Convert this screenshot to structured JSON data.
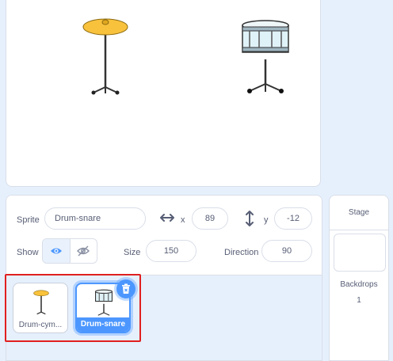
{
  "sprite_info": {
    "sprite_label": "Sprite",
    "sprite_name": "Drum-snare",
    "x_label": "x",
    "x_value": "89",
    "y_label": "y",
    "y_value": "-12",
    "show_label": "Show",
    "size_label": "Size",
    "size_value": "150",
    "direction_label": "Direction",
    "direction_value": "90"
  },
  "sprites": [
    {
      "name": "Drum-cym...",
      "selected": false
    },
    {
      "name": "Drum-snare",
      "selected": true
    }
  ],
  "stage_panel": {
    "title": "Stage",
    "backdrops_label": "Backdrops",
    "backdrops_count": "1"
  },
  "colors": {
    "accent": "#4c97ff",
    "highlight": "#e02020",
    "cymbal": "#f9c23c"
  },
  "icons": [
    "x-arrows-icon",
    "y-arrows-icon",
    "eye-icon",
    "eye-slash-icon",
    "trash-icon"
  ]
}
